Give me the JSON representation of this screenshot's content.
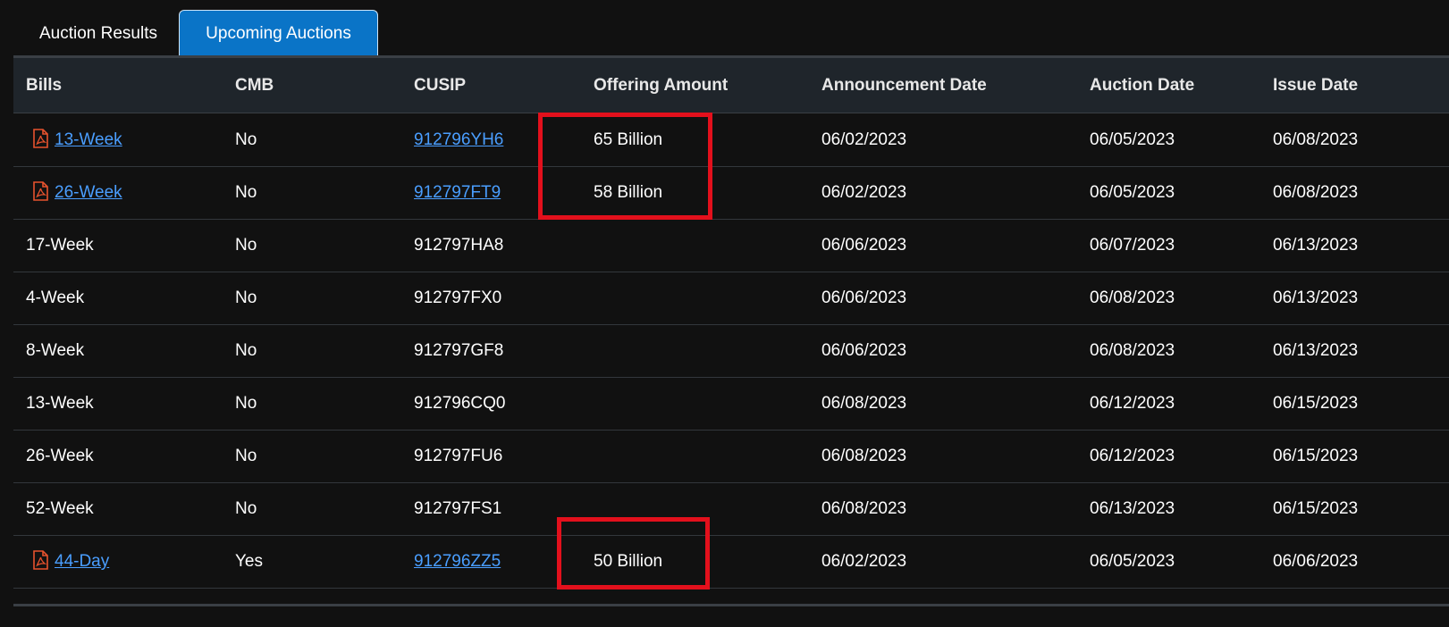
{
  "tabs": [
    {
      "label": "Auction Results",
      "active": false
    },
    {
      "label": "Upcoming Auctions",
      "active": true
    }
  ],
  "table": {
    "headers": {
      "bills": "Bills",
      "cmb": "CMB",
      "cusip": "CUSIP",
      "offering": "Offering Amount",
      "announcement": "Announcement Date",
      "auction": "Auction Date",
      "issue": "Issue Date"
    },
    "rows": [
      {
        "bills": "13-Week",
        "cmb": "No",
        "cusip": "912796YH6",
        "offering": "65 Billion",
        "announcement": "06/02/2023",
        "auction": "06/05/2023",
        "issue": "06/08/2023",
        "has_pdf": true
      },
      {
        "bills": "26-Week",
        "cmb": "No",
        "cusip": "912797FT9",
        "offering": "58 Billion",
        "announcement": "06/02/2023",
        "auction": "06/05/2023",
        "issue": "06/08/2023",
        "has_pdf": true
      },
      {
        "bills": "17-Week",
        "cmb": "No",
        "cusip": "912797HA8",
        "offering": "",
        "announcement": "06/06/2023",
        "auction": "06/07/2023",
        "issue": "06/13/2023",
        "has_pdf": false
      },
      {
        "bills": "4-Week",
        "cmb": "No",
        "cusip": "912797FX0",
        "offering": "",
        "announcement": "06/06/2023",
        "auction": "06/08/2023",
        "issue": "06/13/2023",
        "has_pdf": false
      },
      {
        "bills": "8-Week",
        "cmb": "No",
        "cusip": "912797GF8",
        "offering": "",
        "announcement": "06/06/2023",
        "auction": "06/08/2023",
        "issue": "06/13/2023",
        "has_pdf": false
      },
      {
        "bills": "13-Week",
        "cmb": "No",
        "cusip": "912796CQ0",
        "offering": "",
        "announcement": "06/08/2023",
        "auction": "06/12/2023",
        "issue": "06/15/2023",
        "has_pdf": false
      },
      {
        "bills": "26-Week",
        "cmb": "No",
        "cusip": "912797FU6",
        "offering": "",
        "announcement": "06/08/2023",
        "auction": "06/12/2023",
        "issue": "06/15/2023",
        "has_pdf": false
      },
      {
        "bills": "52-Week",
        "cmb": "No",
        "cusip": "912797FS1",
        "offering": "",
        "announcement": "06/08/2023",
        "auction": "06/13/2023",
        "issue": "06/15/2023",
        "has_pdf": false
      },
      {
        "bills": "44-Day",
        "cmb": "Yes",
        "cusip": "912796ZZ5",
        "offering": "50 Billion",
        "announcement": "06/02/2023",
        "auction": "06/05/2023",
        "issue": "06/06/2023",
        "has_pdf": true
      }
    ]
  },
  "icons": {
    "pdf": "pdf-file-icon"
  },
  "colors": {
    "background": "#111111",
    "header_bg": "#1f252b",
    "active_tab": "#0a74c7",
    "link": "#4a9eff",
    "pdf_icon": "#e8532e",
    "highlight": "#e3101c"
  }
}
